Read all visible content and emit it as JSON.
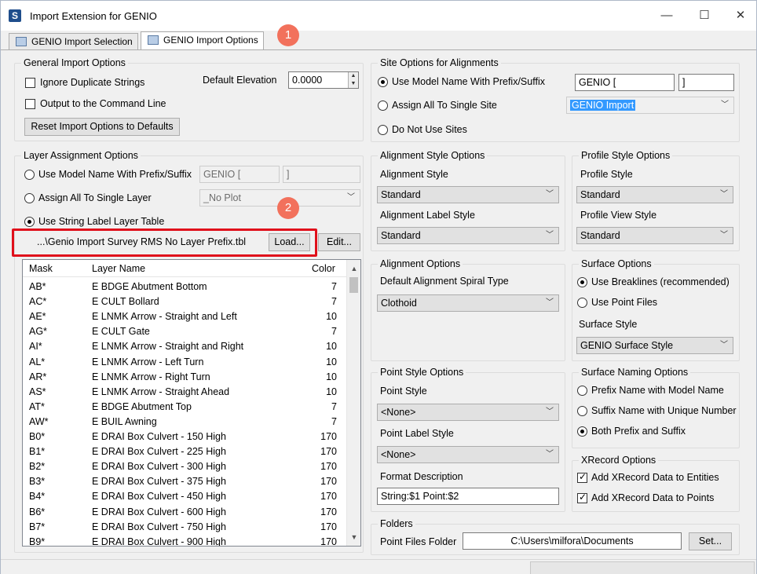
{
  "window": {
    "title": "Import Extension for GENIO",
    "app_icon": "S",
    "minimize": "—",
    "maximize": "☐",
    "close": "✕"
  },
  "tabs": [
    {
      "label": "GENIO Import Selection",
      "active": false
    },
    {
      "label": "GENIO Import Options",
      "active": true
    }
  ],
  "badges": {
    "one": "1",
    "two": "2",
    "color": "#f2715c"
  },
  "general": {
    "title": "General Import Options",
    "ignore_dup": "Ignore Duplicate Strings",
    "output_cmd": "Output to the Command Line",
    "default_elev_label": "Default Elevation",
    "default_elev_value": "0.0000",
    "reset_btn": "Reset Import Options to Defaults"
  },
  "layer": {
    "title": "Layer Assignment Options",
    "opt_model": "Use Model Name With Prefix/Suffix",
    "prefix": "GENIO [",
    "suffix": "]",
    "opt_single": "Assign All To Single Layer",
    "single_layer": "_No Plot",
    "opt_table": "Use String Label Layer Table",
    "table_path": "...\\Genio Import Survey RMS No Layer Prefix.tbl",
    "load_btn": "Load...",
    "edit_btn": "Edit..."
  },
  "table": {
    "headers": {
      "mask": "Mask",
      "name": "Layer Name",
      "color": "Color"
    },
    "rows": [
      {
        "mask": "AB*",
        "name": "E BDGE Abutment Bottom",
        "color": "7"
      },
      {
        "mask": "AC*",
        "name": "E CULT Bollard",
        "color": "7"
      },
      {
        "mask": "AE*",
        "name": "E LNMK Arrow - Straight and Left",
        "color": "10"
      },
      {
        "mask": "AG*",
        "name": "E CULT Gate",
        "color": "7"
      },
      {
        "mask": "AI*",
        "name": "E LNMK Arrow - Straight and Right",
        "color": "10"
      },
      {
        "mask": "AL*",
        "name": "E LNMK Arrow - Left Turn",
        "color": "10"
      },
      {
        "mask": "AR*",
        "name": "E LNMK Arrow - Right Turn",
        "color": "10"
      },
      {
        "mask": "AS*",
        "name": "E LNMK Arrow - Straight Ahead",
        "color": "10"
      },
      {
        "mask": "AT*",
        "name": "E BDGE Abutment Top",
        "color": "7"
      },
      {
        "mask": "AW*",
        "name": "E BUIL Awning",
        "color": "7"
      },
      {
        "mask": "B0*",
        "name": "E DRAI Box Culvert - 150 High",
        "color": "170"
      },
      {
        "mask": "B1*",
        "name": "E DRAI Box Culvert - 225 High",
        "color": "170"
      },
      {
        "mask": "B2*",
        "name": "E DRAI Box Culvert - 300 High",
        "color": "170"
      },
      {
        "mask": "B3*",
        "name": "E DRAI Box Culvert - 375 High",
        "color": "170"
      },
      {
        "mask": "B4*",
        "name": "E DRAI Box Culvert - 450 High",
        "color": "170"
      },
      {
        "mask": "B6*",
        "name": "E DRAI Box Culvert - 600 High",
        "color": "170"
      },
      {
        "mask": "B7*",
        "name": "E DRAI Box Culvert - 750 High",
        "color": "170"
      },
      {
        "mask": "B9*",
        "name": "E DRAI Box Culvert - 900 High",
        "color": "170"
      }
    ]
  },
  "site": {
    "title": "Site Options for Alignments",
    "opt_model": "Use Model Name With Prefix/Suffix",
    "prefix": "GENIO [",
    "suffix": "]",
    "opt_single": "Assign All To Single Site",
    "single_site": "GENIO Import",
    "opt_none": "Do Not Use Sites"
  },
  "align_style": {
    "title": "Alignment Style Options",
    "style_label": "Alignment Style",
    "style_value": "Standard",
    "label_style_label": "Alignment Label Style",
    "label_style_value": "Standard"
  },
  "profile_style": {
    "title": "Profile Style Options",
    "style_label": "Profile Style",
    "style_value": "Standard",
    "view_label": "Profile View Style",
    "view_value": "Standard"
  },
  "align_opts": {
    "title": "Alignment Options",
    "spiral_label": "Default Alignment Spiral Type",
    "spiral_value": "Clothoid"
  },
  "surface": {
    "title": "Surface Options",
    "opt_break": "Use Breaklines (recommended)",
    "opt_points": "Use Point Files",
    "style_label": "Surface Style",
    "style_value": "GENIO Surface Style"
  },
  "point_style": {
    "title": "Point Style Options",
    "style_label": "Point Style",
    "style_value": "<None>",
    "label_label": "Point Label Style",
    "label_value": "<None>",
    "format_label": "Format Description",
    "format_value": "String:$1 Point:$2"
  },
  "naming": {
    "title": "Surface Naming Options",
    "opt_prefix": "Prefix Name with Model Name",
    "opt_suffix": "Suffix Name with Unique Number",
    "opt_both": "Both Prefix and Suffix"
  },
  "xrecord": {
    "title": "XRecord Options",
    "entities": "Add XRecord Data to Entities",
    "points": "Add XRecord Data to Points"
  },
  "folders": {
    "title": "Folders",
    "point_label": "Point Files Folder",
    "point_value": "C:\\Users\\milfora\\Documents",
    "set_btn": "Set..."
  }
}
